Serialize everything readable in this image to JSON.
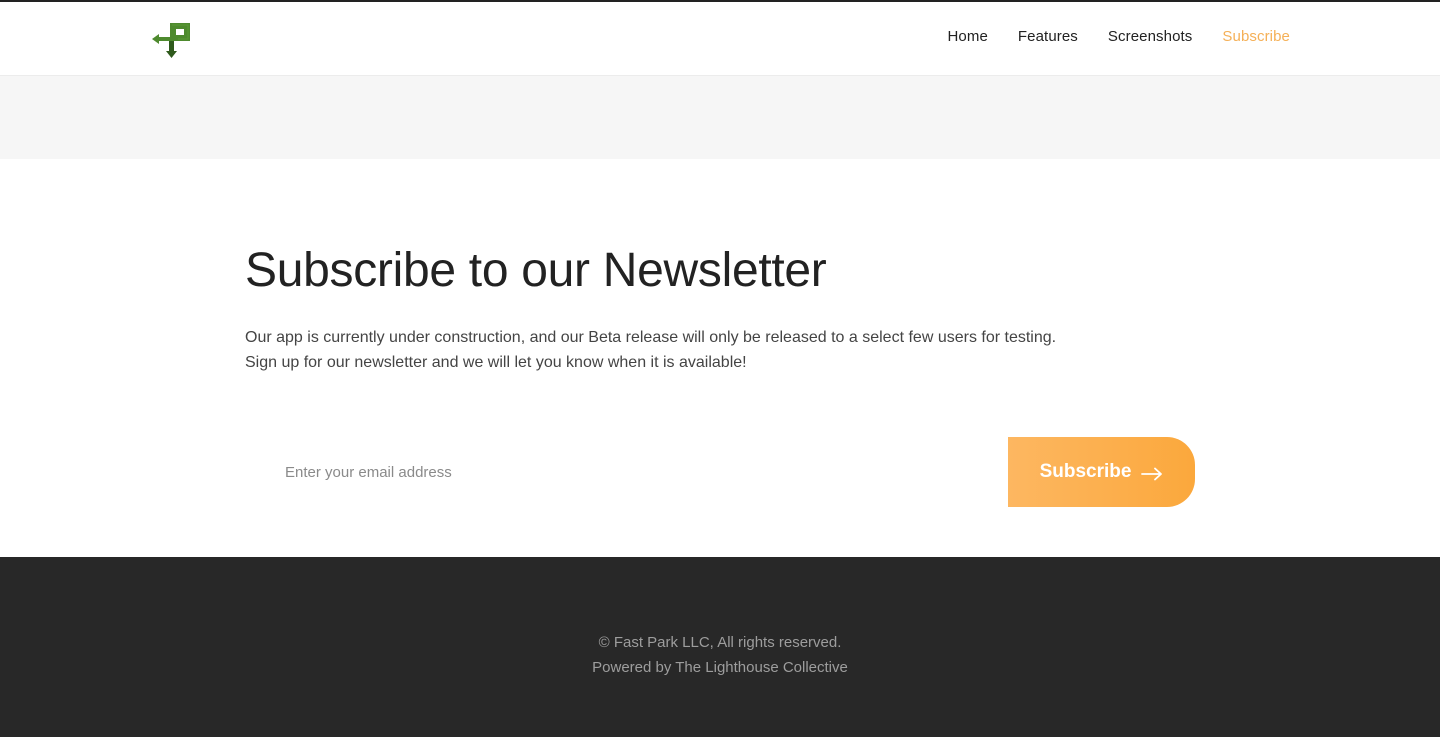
{
  "header": {
    "logo_icon": "parking-arrow-logo",
    "nav": [
      {
        "label": "Home",
        "active": false
      },
      {
        "label": "Features",
        "active": false
      },
      {
        "label": "Screenshots",
        "active": false
      },
      {
        "label": "Subscribe",
        "active": true
      }
    ]
  },
  "main": {
    "title": "Subscribe to our Newsletter",
    "description_line1": "Our app is currently under construction, and our Beta release will only be released to a select few users for testing.",
    "description_line2": "Sign up for our newsletter and we will let you know when it is available!",
    "email_placeholder": "Enter your email address",
    "email_value": "",
    "subscribe_label": "Subscribe",
    "subscribe_icon": "arrow-right-icon"
  },
  "footer": {
    "copyright": "© Fast Park LLC, All rights reserved.",
    "powered_by": "Powered by The Lighthouse Collective"
  },
  "colors": {
    "accent": "#f5b057",
    "button_gradient_start": "#fdb761",
    "button_gradient_end": "#fba83c",
    "logo_green": "#4e8a2e",
    "footer_bg": "#282828",
    "band_bg": "#f6f6f6"
  }
}
